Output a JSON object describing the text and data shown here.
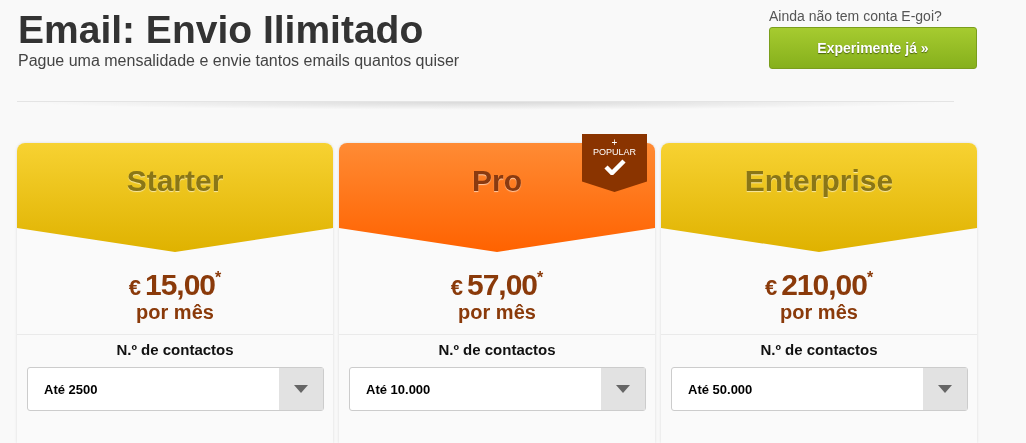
{
  "header": {
    "title": "Email: Envio Ilimitado",
    "subtitle": "Pague uma mensalidade e envie tantos emails quantos quiser",
    "signup_prompt": "Ainda não tem conta E-goi?",
    "signup_button": "Experimente já »"
  },
  "plans": [
    {
      "kind": "standard",
      "name": "Starter",
      "currency": "€",
      "amount": "15,00",
      "footnote_mark": "*",
      "period": "por mês",
      "contacts_label": "N.º de contactos",
      "contacts_value": "Até 2500"
    },
    {
      "kind": "featured",
      "name": "Pro",
      "badge": {
        "plus": "+",
        "label": "POPULAR"
      },
      "currency": "€",
      "amount": "57,00",
      "footnote_mark": "*",
      "period": "por mês",
      "contacts_label": "N.º de contactos",
      "contacts_value": "Até 10.000"
    },
    {
      "kind": "standard",
      "name": "Enterprise",
      "currency": "€",
      "amount": "210,00",
      "footnote_mark": "*",
      "period": "por mês",
      "contacts_label": "N.º de contactos",
      "contacts_value": "Até 50.000"
    }
  ]
}
